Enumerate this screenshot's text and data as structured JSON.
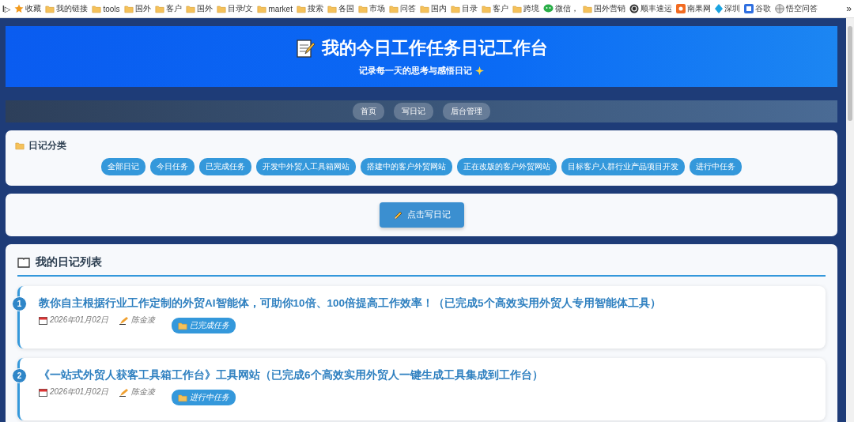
{
  "bookmarks_bar": {
    "sidebar_toggle": "I▷",
    "items": [
      {
        "label": "收藏",
        "kind": "star"
      },
      {
        "label": "我的链接",
        "kind": "folder"
      },
      {
        "label": "tools",
        "kind": "folder"
      },
      {
        "label": "国外",
        "kind": "folder"
      },
      {
        "label": "客户",
        "kind": "folder"
      },
      {
        "label": "国外",
        "kind": "folder"
      },
      {
        "label": "目录/文",
        "kind": "folder"
      },
      {
        "label": "market",
        "kind": "folder"
      },
      {
        "label": "搜索",
        "kind": "folder"
      },
      {
        "label": "各国",
        "kind": "folder"
      },
      {
        "label": "市场",
        "kind": "folder"
      },
      {
        "label": "问答",
        "kind": "folder"
      },
      {
        "label": "国内",
        "kind": "folder"
      },
      {
        "label": "目录",
        "kind": "folder"
      },
      {
        "label": "客户",
        "kind": "folder"
      },
      {
        "label": "跨境",
        "kind": "folder"
      },
      {
        "label": "微信，",
        "kind": "chat"
      },
      {
        "label": "国外营销",
        "kind": "folder"
      },
      {
        "label": "顺丰速运",
        "kind": "site"
      },
      {
        "label": "南果网",
        "kind": "shop"
      },
      {
        "label": "深圳",
        "kind": "diamond"
      },
      {
        "label": "谷歌",
        "kind": "box"
      },
      {
        "label": "悟空问答",
        "kind": "globe"
      }
    ],
    "more": "»"
  },
  "header": {
    "title": "我的今日工作任务日记工作台",
    "subtitle": "记录每一天的思考与感悟日记"
  },
  "nav": [
    {
      "label": "首页"
    },
    {
      "label": "写日记"
    },
    {
      "label": "后台管理"
    }
  ],
  "categories": {
    "title": "日记分类",
    "tags": [
      "全部日记",
      "今日任务",
      "已完成任务",
      "开发中外贸人工具箱网站",
      "搭建中的客户外贸网站",
      "正在改版的客户外贸网站",
      "目标客户人群行业产品项目开发",
      "进行中任务"
    ]
  },
  "write_button": "点击写日记",
  "diary_list": {
    "title": "我的日记列表",
    "entries": [
      {
        "number": "1",
        "title": "教你自主根据行业工作定制的外贸AI智能体，可助你10倍、100倍提高工作效率！（已完成5个高效实用外贸人专用智能体工具）",
        "date": "2026年01月02日",
        "author": "陈金凌",
        "category": "已完成任务"
      },
      {
        "number": "2",
        "title": "《一站式外贸人获客工具箱工作台》工具网站（已完成6个高效实用外贸人一键生成工具集成到工作台）",
        "date": "2026年01月02日",
        "author": "陈金凌",
        "category": "进行中任务"
      }
    ]
  }
}
